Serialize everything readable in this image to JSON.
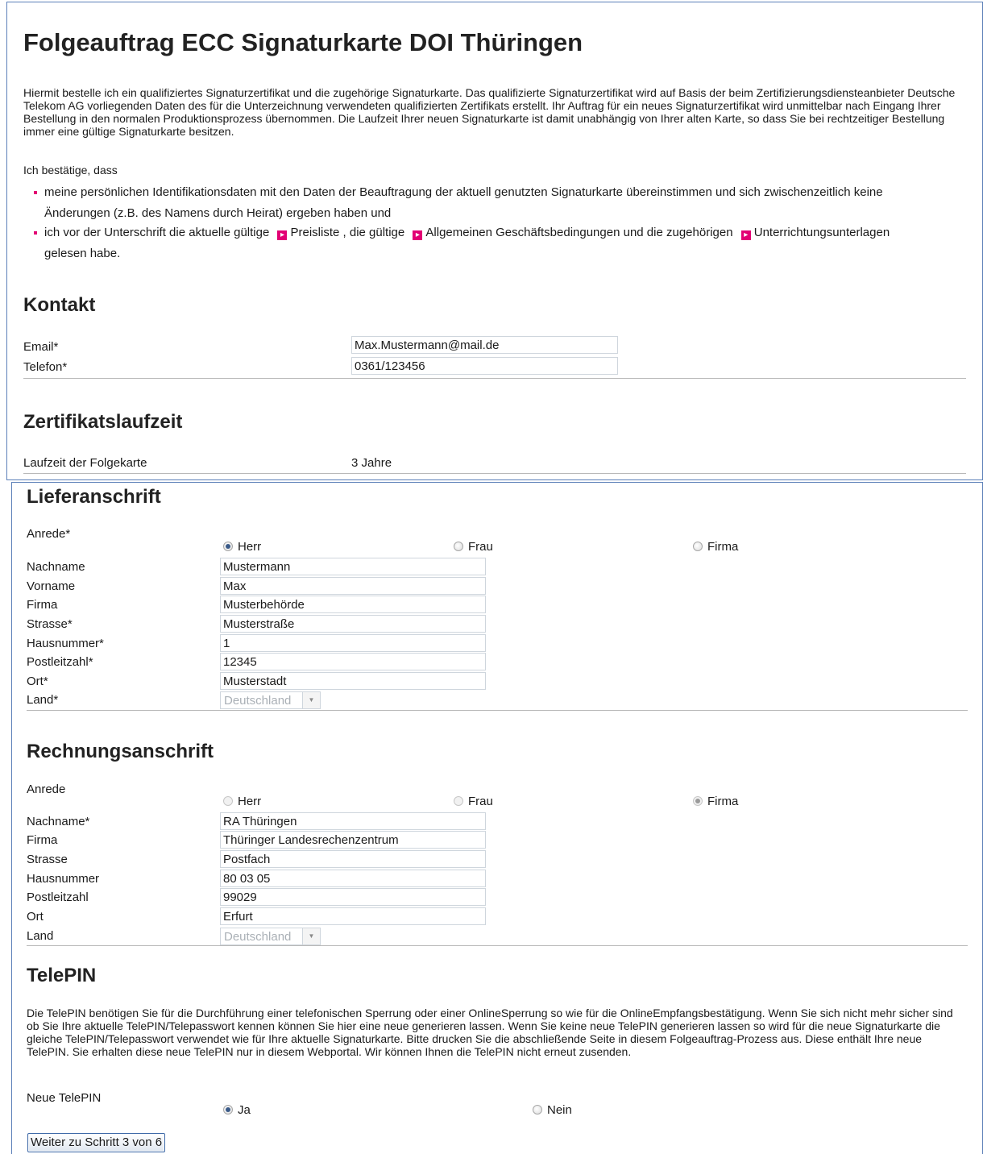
{
  "page_title": "Folgeauftrag ECC Signaturkarte DOI Thüringen",
  "intro": "Hiermit bestelle ich ein qualifiziertes Signaturzertifikat und die zugehörige Signaturkarte. Das qualifizierte Signaturzertifikat wird auf Basis der beim Zertifizierungsdiensteanbieter Deutsche Telekom AG vorliegenden Daten des für die Unterzeichnung verwendeten qualifizierten Zertifikats erstellt. Ihr Auftrag für ein neues Signaturzertifikat wird unmittelbar nach Eingang Ihrer Bestellung in den normalen Produktionsprozess übernommen. Die Laufzeit Ihrer neuen Signaturkarte ist damit unabhängig von Ihrer alten Karte, so dass Sie bei rechtzeitiger Bestellung immer eine gültige Signaturkarte besitzen.",
  "confirm_heading": "Ich bestätige, dass",
  "bullets": {
    "b1_line1": "meine persönlichen Identifikationsdaten mit den Daten der Beauftragung der aktuell genutzten Signaturkarte übereinstimmen und sich zwischenzeitlich keine",
    "b1_line2": "Änderungen (z.B. des Namens durch Heirat) ergeben haben und",
    "b2_pre": "ich vor der Unterschrift die aktuelle gültige",
    "b2_link1": "Preisliste",
    "b2_mid1": ", die gültige",
    "b2_link2": "Allgemeinen Geschäftsbedingungen",
    "b2_mid2": "und die zugehörigen",
    "b2_link3": "Unterrichtungsunterlagen",
    "b2_line2": "gelesen habe."
  },
  "kontakt": {
    "title": "Kontakt",
    "email_label": "Email*",
    "email_value": "Max.Mustermann@mail.de",
    "telefon_label": "Telefon*",
    "telefon_value": "0361/123456"
  },
  "laufzeit": {
    "title": "Zertifikatslaufzeit",
    "label": "Laufzeit der Folgekarte",
    "value": "3 Jahre"
  },
  "liefer": {
    "title": "Lieferanschrift",
    "anrede_label": "Anrede*",
    "anrede_options": [
      "Herr",
      "Frau",
      "Firma"
    ],
    "anrede_selected": "Herr",
    "nachname_label": "Nachname",
    "nachname_value": "Mustermann",
    "vorname_label": "Vorname",
    "vorname_value": "Max",
    "firma_label": "Firma",
    "firma_value": "Musterbehörde",
    "strasse_label": "Strasse*",
    "strasse_value": "Musterstraße",
    "hausnummer_label": "Hausnummer*",
    "hausnummer_value": "1",
    "plz_label": "Postleitzahl*",
    "plz_value": "12345",
    "ort_label": "Ort*",
    "ort_value": "Musterstadt",
    "land_label": "Land*",
    "land_value": "Deutschland"
  },
  "rechnung": {
    "title": "Rechnungsanschrift",
    "anrede_label": "Anrede",
    "anrede_options": [
      "Herr",
      "Frau",
      "Firma"
    ],
    "anrede_selected": "Firma",
    "nachname_label": "Nachname*",
    "nachname_value": "RA Thüringen",
    "firma_label": "Firma",
    "firma_value": "Thüringer Landesrechenzentrum",
    "strasse_label": "Strasse",
    "strasse_value": "Postfach",
    "hausnummer_label": "Hausnummer",
    "hausnummer_value": "80 03 05",
    "plz_label": "Postleitzahl",
    "plz_value": "99029",
    "ort_label": "Ort",
    "ort_value": "Erfurt",
    "land_label": "Land",
    "land_value": "Deutschland"
  },
  "telepin": {
    "title": "TelePIN",
    "text": "Die TelePIN benötigen Sie für die Durchführung einer telefonischen Sperrung oder einer OnlineSperrung so wie für die OnlineEmpfangsbestätigung. Wenn Sie sich nicht mehr sicher sind ob Sie Ihre aktuelle TelePIN/Telepasswort kennen können Sie hier eine neue generieren lassen. Wenn Sie keine neue TelePIN generieren lassen so wird für die neue Signaturkarte die gleiche TelePIN/Telepasswort verwendet wie für Ihre aktuelle Signaturkarte. Bitte drucken Sie die abschließende Seite in diesem Folgeauftrag-Prozess aus. Diese enthält Ihre neue TelePIN. Sie erhalten diese neue TelePIN nur in diesem Webportal. Wir können Ihnen die TelePIN nicht erneut zusenden.",
    "neue_label": "Neue TelePIN",
    "options": [
      "Ja",
      "Nein"
    ],
    "selected": "Ja"
  },
  "submit_label": "Weiter zu Schritt 3 von 6",
  "colors": {
    "accent_magenta": "#e20074",
    "panel_border": "#5b7fb8",
    "button_border": "#3f6aa8"
  }
}
